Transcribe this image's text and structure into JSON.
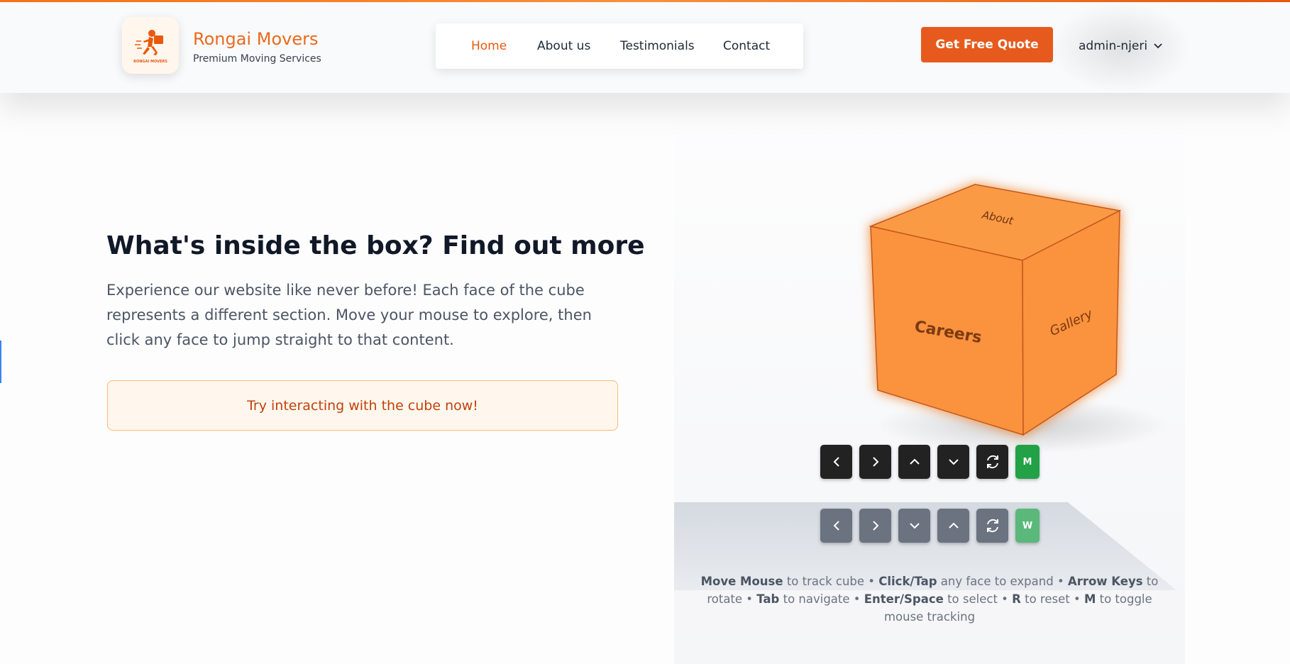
{
  "header": {
    "brand_name": "Rongai Movers",
    "brand_tagline": "Premium Moving Services",
    "logo_text": "RONGAI MOVERS",
    "nav": [
      {
        "label": "Home",
        "active": true
      },
      {
        "label": "About us",
        "active": false
      },
      {
        "label": "Testimonials",
        "active": false
      },
      {
        "label": "Contact",
        "active": false
      }
    ],
    "cta_label": "Get Free Quote",
    "user_name": "admin-njeri",
    "user_icon": "chevron-down-icon"
  },
  "hero": {
    "title": "What's inside the box? Find out more",
    "description": "Experience our website like never before! Each face of the cube represents a different section. Move your mouse to explore, then click any face to jump straight to that content.",
    "cta_box_text": "Try interacting with the cube now!"
  },
  "cube": {
    "faces": {
      "top": "About",
      "front": "Careers",
      "right": "Gallery"
    },
    "color": "#fb923c"
  },
  "controls": {
    "mouse_toggle_label": "M",
    "mouse_toggle_label_secondary": "W",
    "primary_icons": [
      "chevron-left-icon",
      "chevron-right-icon",
      "chevron-up-icon",
      "chevron-down-icon",
      "refresh-icon"
    ],
    "secondary_icons": [
      "chevron-left-icon",
      "chevron-right-icon",
      "chevron-down-icon",
      "chevron-up-icon",
      "refresh-icon"
    ]
  },
  "help": {
    "parts": [
      {
        "bold": "Move Mouse",
        "text": " to track cube • "
      },
      {
        "bold": "Click/Tap",
        "text": " any face to expand • "
      },
      {
        "bold": "Arrow Keys",
        "text": " to rotate • "
      },
      {
        "bold": "Tab",
        "text": " to navigate • "
      },
      {
        "bold": "Enter/Space",
        "text": " to select • "
      },
      {
        "bold": "R",
        "text": " to reset • "
      },
      {
        "bold": "M",
        "text": " to toggle mouse tracking"
      }
    ]
  },
  "colors": {
    "accent": "#ea580c",
    "mouse_toggle_active": "#22a147"
  }
}
